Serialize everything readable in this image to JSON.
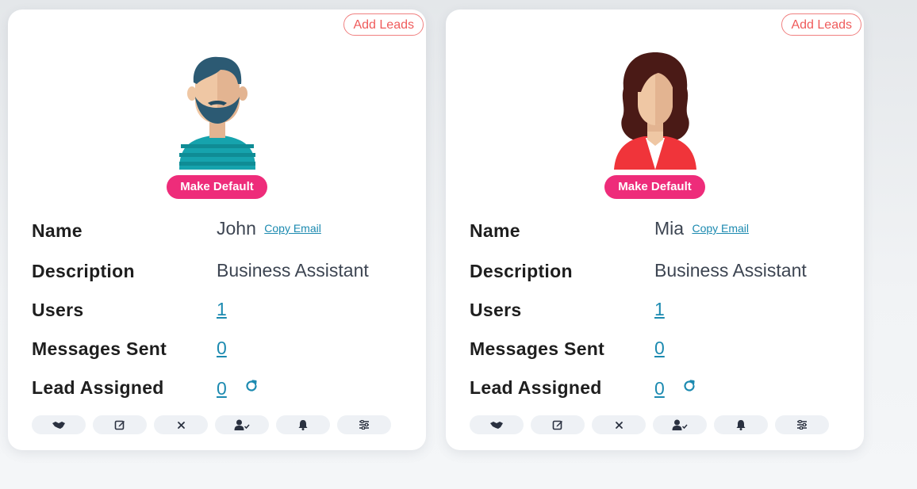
{
  "cards": [
    {
      "add_leads": "Add Leads",
      "make_default": "Make Default",
      "avatar_icon": "male-avatar-icon",
      "labels": {
        "name": "Name",
        "description": "Description",
        "users": "Users",
        "messages_sent": "Messages Sent",
        "lead_assigned": "Lead Assigned"
      },
      "name": "John",
      "copy_email": "Copy Email",
      "description": "Business Assistant",
      "users": "1",
      "messages_sent": "0",
      "lead_assigned": "0"
    },
    {
      "add_leads": "Add Leads",
      "make_default": "Make Default",
      "avatar_icon": "female-avatar-icon",
      "labels": {
        "name": "Name",
        "description": "Description",
        "users": "Users",
        "messages_sent": "Messages Sent",
        "lead_assigned": "Lead Assigned"
      },
      "name": "Mia",
      "copy_email": "Copy Email",
      "description": "Business Assistant",
      "users": "1",
      "messages_sent": "0",
      "lead_assigned": "0"
    }
  ],
  "action_icons": [
    "handshake-icon",
    "edit-icon",
    "close-icon",
    "user-check-icon",
    "bell-icon",
    "sliders-icon"
  ],
  "colors": {
    "accent_pink": "#ee2c7a",
    "add_leads_red": "#ef5b5b",
    "link_blue": "#1c8ab0"
  }
}
